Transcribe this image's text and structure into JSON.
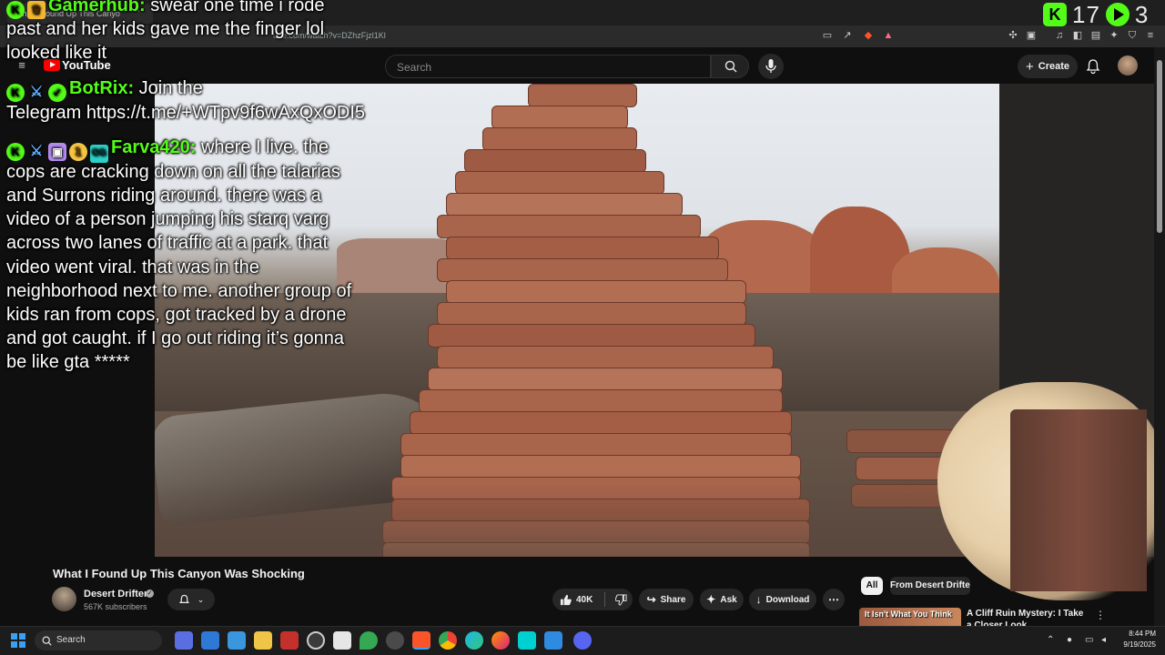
{
  "browser": {
    "tab_title": "What I Found Up This Canyo",
    "tab_close": "×",
    "url": "ube.com/watch?v=DZhzFjzl1Kl"
  },
  "kick": {
    "badge": "K",
    "viewers": "17",
    "second_count": "3"
  },
  "youtube": {
    "logo_text": "YouTube",
    "search_placeholder": "Search",
    "create_label": "Create"
  },
  "chat": [
    {
      "badges": [
        "kick",
        "crown"
      ],
      "username": "Gamerhub:",
      "lines": [
        "swear one time i rode",
        "past and her kids gave me the finger lol",
        "looked like it"
      ]
    },
    {
      "badges": [
        "kick",
        "mod",
        "verified"
      ],
      "username": "BotRix:",
      "lines": [
        "Join the",
        "Telegram https://t.me/+WTpv9f6wAxQxODI5"
      ]
    },
    {
      "badges": [
        "kick",
        "mod",
        "gift",
        "one",
        "og"
      ],
      "username": "Farva420:",
      "lines": [
        "where I live. the",
        "cops are cracking down on all the talarias",
        "and Surrons riding around. there was a",
        "video of a person jumping his starq varg",
        "across two lanes of traffic at a park. that",
        "video went viral. that was in the",
        "neighborhood next to me. another group of",
        "kids ran from cops, got tracked by a drone",
        "and got caught. if I go out riding it’s gonna",
        "be like gta *****"
      ]
    }
  ],
  "video": {
    "title": "What I Found Up This Canyon Was Shocking",
    "channel": "Desert Drifter",
    "subscribers": "567K subscribers",
    "likes": "40K",
    "share_label": "Share",
    "ask_label": "Ask",
    "download_label": "Download"
  },
  "sidebar": {
    "chips": [
      "All",
      "From Desert Drifter"
    ],
    "recommendation": {
      "thumb_text": "It Isn't What You Think",
      "title": "A Cliff Ruin Mystery: I Take a Closer Look"
    }
  },
  "taskbar": {
    "search_label": "Search",
    "time": "8:44 PM",
    "date": "9/19/2025"
  },
  "colors": {
    "kick_green": "#53fc18",
    "youtube_red": "#ff0000",
    "bg": "#0f0f0f"
  }
}
